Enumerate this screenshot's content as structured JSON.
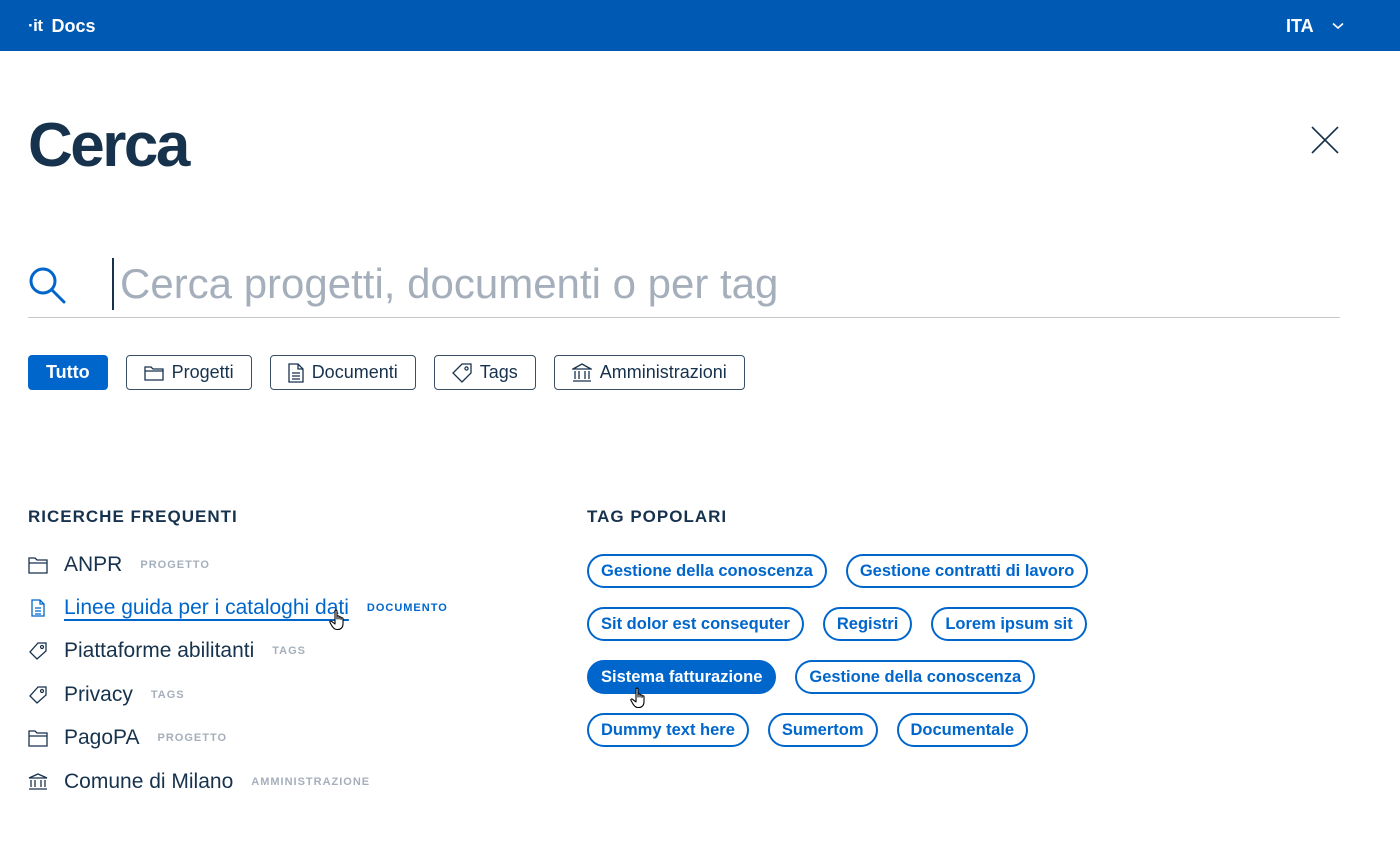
{
  "header": {
    "brand_mark": "·it",
    "brand_name": "Docs",
    "language": "ITA"
  },
  "page": {
    "title": "Cerca"
  },
  "search": {
    "placeholder": "Cerca progetti, documenti o per tag",
    "value": ""
  },
  "filters": [
    {
      "label": "Tutto",
      "icon": "",
      "active": true
    },
    {
      "label": "Progetti",
      "icon": "folder-icon",
      "active": false
    },
    {
      "label": "Documenti",
      "icon": "document-icon",
      "active": false
    },
    {
      "label": "Tags",
      "icon": "tag-icon",
      "active": false
    },
    {
      "label": "Amministrazioni",
      "icon": "institution-icon",
      "active": false
    }
  ],
  "recent": {
    "heading": "RICERCHE FREQUENTI",
    "items": [
      {
        "label": "ANPR",
        "type": "PROGETTO",
        "icon": "folder-icon"
      },
      {
        "label": "Linee guida per i cataloghi dati",
        "type": "DOCUMENTO",
        "icon": "document-icon",
        "hovered": true
      },
      {
        "label": "Piattaforme abilitanti",
        "type": "TAGS",
        "icon": "tag-icon"
      },
      {
        "label": "Privacy",
        "type": "TAGS",
        "icon": "tag-icon"
      },
      {
        "label": "PagoPA",
        "type": "PROGETTO",
        "icon": "folder-icon"
      },
      {
        "label": "Comune di Milano",
        "type": "AMMINISTRAZIONE",
        "icon": "institution-icon"
      }
    ]
  },
  "popular_tags": {
    "heading": "TAG POPOLARI",
    "rows": [
      [
        "Gestione della conoscenza",
        "Gestione contratti di lavoro"
      ],
      [
        "Sit dolor est consequter",
        "Registri",
        "Lorem ipsum sit"
      ],
      [
        "Sistema fatturazione",
        "Gestione della conoscenza"
      ],
      [
        "Dummy text here",
        "Sumertom",
        "Documentale"
      ]
    ],
    "active_tag": "Sistema fatturazione"
  },
  "colors": {
    "primary": "#0066cc",
    "header_bg": "#0059b3",
    "text_dark": "#17324d",
    "text_muted": "#a5afbb"
  }
}
